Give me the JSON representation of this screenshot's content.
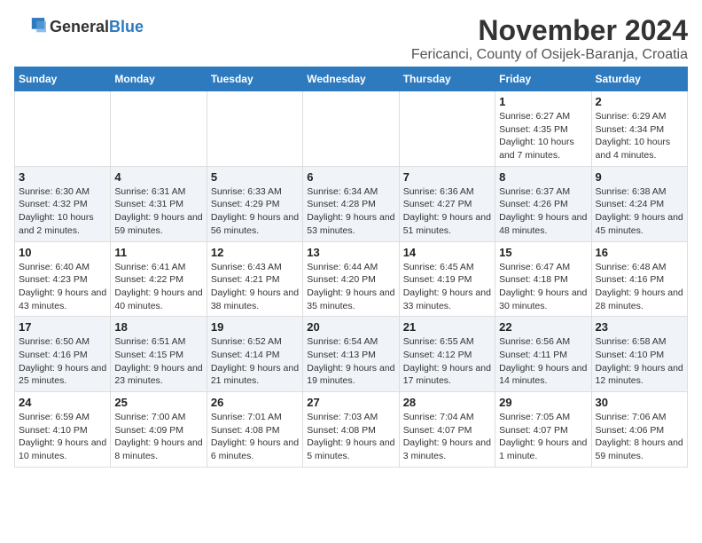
{
  "header": {
    "logo_general": "General",
    "logo_blue": "Blue",
    "month_title": "November 2024",
    "location": "Fericanci, County of Osijek-Baranja, Croatia"
  },
  "weekdays": [
    "Sunday",
    "Monday",
    "Tuesday",
    "Wednesday",
    "Thursday",
    "Friday",
    "Saturday"
  ],
  "weeks": [
    [
      {
        "day": "",
        "info": ""
      },
      {
        "day": "",
        "info": ""
      },
      {
        "day": "",
        "info": ""
      },
      {
        "day": "",
        "info": ""
      },
      {
        "day": "",
        "info": ""
      },
      {
        "day": "1",
        "info": "Sunrise: 6:27 AM\nSunset: 4:35 PM\nDaylight: 10 hours and 7 minutes."
      },
      {
        "day": "2",
        "info": "Sunrise: 6:29 AM\nSunset: 4:34 PM\nDaylight: 10 hours and 4 minutes."
      }
    ],
    [
      {
        "day": "3",
        "info": "Sunrise: 6:30 AM\nSunset: 4:32 PM\nDaylight: 10 hours and 2 minutes."
      },
      {
        "day": "4",
        "info": "Sunrise: 6:31 AM\nSunset: 4:31 PM\nDaylight: 9 hours and 59 minutes."
      },
      {
        "day": "5",
        "info": "Sunrise: 6:33 AM\nSunset: 4:29 PM\nDaylight: 9 hours and 56 minutes."
      },
      {
        "day": "6",
        "info": "Sunrise: 6:34 AM\nSunset: 4:28 PM\nDaylight: 9 hours and 53 minutes."
      },
      {
        "day": "7",
        "info": "Sunrise: 6:36 AM\nSunset: 4:27 PM\nDaylight: 9 hours and 51 minutes."
      },
      {
        "day": "8",
        "info": "Sunrise: 6:37 AM\nSunset: 4:26 PM\nDaylight: 9 hours and 48 minutes."
      },
      {
        "day": "9",
        "info": "Sunrise: 6:38 AM\nSunset: 4:24 PM\nDaylight: 9 hours and 45 minutes."
      }
    ],
    [
      {
        "day": "10",
        "info": "Sunrise: 6:40 AM\nSunset: 4:23 PM\nDaylight: 9 hours and 43 minutes."
      },
      {
        "day": "11",
        "info": "Sunrise: 6:41 AM\nSunset: 4:22 PM\nDaylight: 9 hours and 40 minutes."
      },
      {
        "day": "12",
        "info": "Sunrise: 6:43 AM\nSunset: 4:21 PM\nDaylight: 9 hours and 38 minutes."
      },
      {
        "day": "13",
        "info": "Sunrise: 6:44 AM\nSunset: 4:20 PM\nDaylight: 9 hours and 35 minutes."
      },
      {
        "day": "14",
        "info": "Sunrise: 6:45 AM\nSunset: 4:19 PM\nDaylight: 9 hours and 33 minutes."
      },
      {
        "day": "15",
        "info": "Sunrise: 6:47 AM\nSunset: 4:18 PM\nDaylight: 9 hours and 30 minutes."
      },
      {
        "day": "16",
        "info": "Sunrise: 6:48 AM\nSunset: 4:16 PM\nDaylight: 9 hours and 28 minutes."
      }
    ],
    [
      {
        "day": "17",
        "info": "Sunrise: 6:50 AM\nSunset: 4:16 PM\nDaylight: 9 hours and 25 minutes."
      },
      {
        "day": "18",
        "info": "Sunrise: 6:51 AM\nSunset: 4:15 PM\nDaylight: 9 hours and 23 minutes."
      },
      {
        "day": "19",
        "info": "Sunrise: 6:52 AM\nSunset: 4:14 PM\nDaylight: 9 hours and 21 minutes."
      },
      {
        "day": "20",
        "info": "Sunrise: 6:54 AM\nSunset: 4:13 PM\nDaylight: 9 hours and 19 minutes."
      },
      {
        "day": "21",
        "info": "Sunrise: 6:55 AM\nSunset: 4:12 PM\nDaylight: 9 hours and 17 minutes."
      },
      {
        "day": "22",
        "info": "Sunrise: 6:56 AM\nSunset: 4:11 PM\nDaylight: 9 hours and 14 minutes."
      },
      {
        "day": "23",
        "info": "Sunrise: 6:58 AM\nSunset: 4:10 PM\nDaylight: 9 hours and 12 minutes."
      }
    ],
    [
      {
        "day": "24",
        "info": "Sunrise: 6:59 AM\nSunset: 4:10 PM\nDaylight: 9 hours and 10 minutes."
      },
      {
        "day": "25",
        "info": "Sunrise: 7:00 AM\nSunset: 4:09 PM\nDaylight: 9 hours and 8 minutes."
      },
      {
        "day": "26",
        "info": "Sunrise: 7:01 AM\nSunset: 4:08 PM\nDaylight: 9 hours and 6 minutes."
      },
      {
        "day": "27",
        "info": "Sunrise: 7:03 AM\nSunset: 4:08 PM\nDaylight: 9 hours and 5 minutes."
      },
      {
        "day": "28",
        "info": "Sunrise: 7:04 AM\nSunset: 4:07 PM\nDaylight: 9 hours and 3 minutes."
      },
      {
        "day": "29",
        "info": "Sunrise: 7:05 AM\nSunset: 4:07 PM\nDaylight: 9 hours and 1 minute."
      },
      {
        "day": "30",
        "info": "Sunrise: 7:06 AM\nSunset: 4:06 PM\nDaylight: 8 hours and 59 minutes."
      }
    ]
  ]
}
